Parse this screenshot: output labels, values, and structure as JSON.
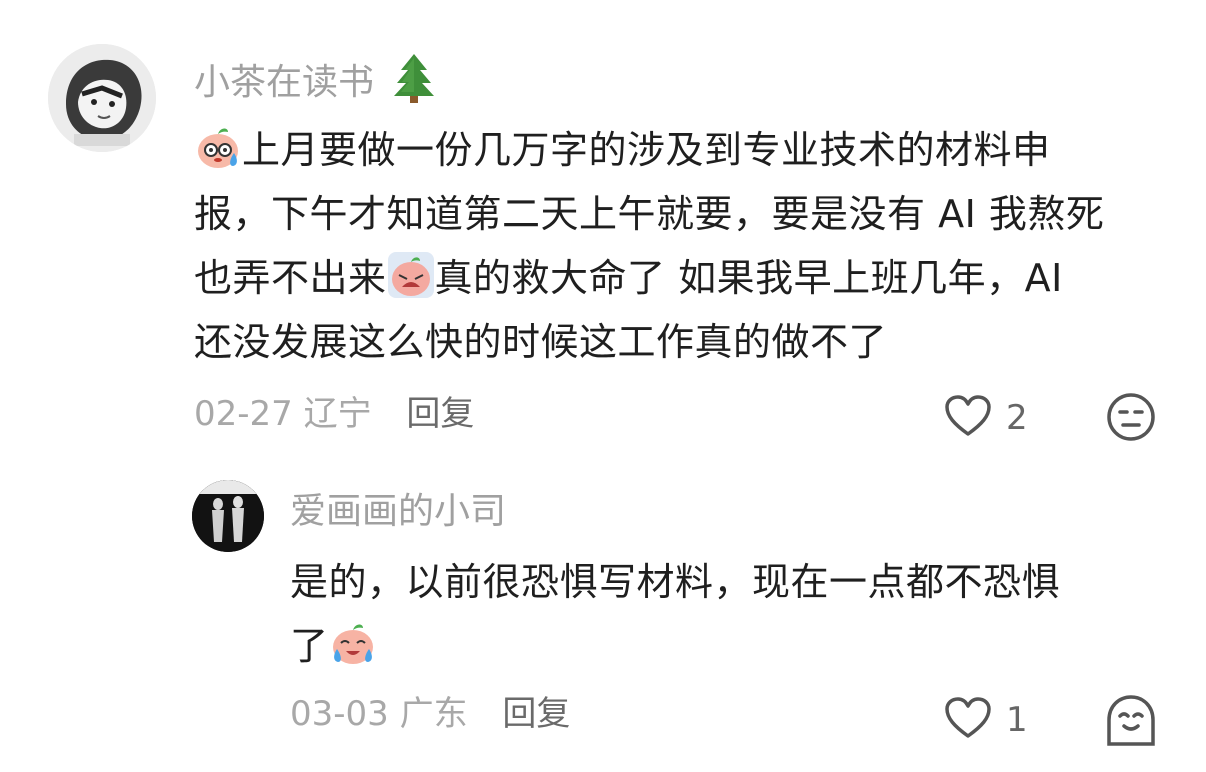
{
  "comment": {
    "username": "小茶在读书",
    "username_icon": "pine-tree-icon",
    "text_lines": [
      "上月要做一份几万字的涉及到专业技术的材料申",
      "报，下午才知道第二天上午就要，要是没有 AI 我熬死",
      "也弄不出来",
      "真的救大命了  如果我早上班几年，AI",
      "还没发展这么快的时候这工作真的做不了"
    ],
    "date": "02-27",
    "location": "辽宁",
    "reply_label": "回复",
    "like_count": "2"
  },
  "reply": {
    "username": "爱画画的小司",
    "text_lines": [
      "是的，以前很恐惧写材料，现在一点都不恐惧",
      "了"
    ],
    "date": "03-03",
    "location": "广东",
    "reply_label": "回复",
    "like_count": "1"
  },
  "colors": {
    "username": "#a0a0a0",
    "text": "#1f1f1f",
    "meta": "#a8a8a8"
  }
}
